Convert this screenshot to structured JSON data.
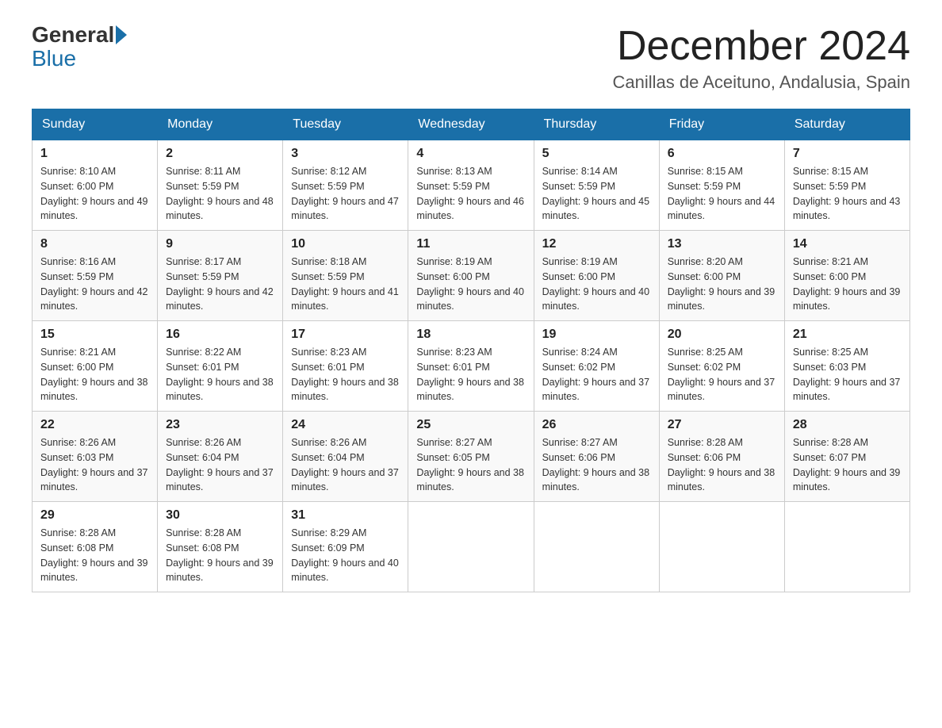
{
  "header": {
    "logo_general": "General",
    "logo_blue": "Blue",
    "month_title": "December 2024",
    "location": "Canillas de Aceituno, Andalusia, Spain"
  },
  "days_of_week": [
    "Sunday",
    "Monday",
    "Tuesday",
    "Wednesday",
    "Thursday",
    "Friday",
    "Saturday"
  ],
  "weeks": [
    [
      {
        "day": "1",
        "sunrise": "8:10 AM",
        "sunset": "6:00 PM",
        "daylight": "9 hours and 49 minutes."
      },
      {
        "day": "2",
        "sunrise": "8:11 AM",
        "sunset": "5:59 PM",
        "daylight": "9 hours and 48 minutes."
      },
      {
        "day": "3",
        "sunrise": "8:12 AM",
        "sunset": "5:59 PM",
        "daylight": "9 hours and 47 minutes."
      },
      {
        "day": "4",
        "sunrise": "8:13 AM",
        "sunset": "5:59 PM",
        "daylight": "9 hours and 46 minutes."
      },
      {
        "day": "5",
        "sunrise": "8:14 AM",
        "sunset": "5:59 PM",
        "daylight": "9 hours and 45 minutes."
      },
      {
        "day": "6",
        "sunrise": "8:15 AM",
        "sunset": "5:59 PM",
        "daylight": "9 hours and 44 minutes."
      },
      {
        "day": "7",
        "sunrise": "8:15 AM",
        "sunset": "5:59 PM",
        "daylight": "9 hours and 43 minutes."
      }
    ],
    [
      {
        "day": "8",
        "sunrise": "8:16 AM",
        "sunset": "5:59 PM",
        "daylight": "9 hours and 42 minutes."
      },
      {
        "day": "9",
        "sunrise": "8:17 AM",
        "sunset": "5:59 PM",
        "daylight": "9 hours and 42 minutes."
      },
      {
        "day": "10",
        "sunrise": "8:18 AM",
        "sunset": "5:59 PM",
        "daylight": "9 hours and 41 minutes."
      },
      {
        "day": "11",
        "sunrise": "8:19 AM",
        "sunset": "6:00 PM",
        "daylight": "9 hours and 40 minutes."
      },
      {
        "day": "12",
        "sunrise": "8:19 AM",
        "sunset": "6:00 PM",
        "daylight": "9 hours and 40 minutes."
      },
      {
        "day": "13",
        "sunrise": "8:20 AM",
        "sunset": "6:00 PM",
        "daylight": "9 hours and 39 minutes."
      },
      {
        "day": "14",
        "sunrise": "8:21 AM",
        "sunset": "6:00 PM",
        "daylight": "9 hours and 39 minutes."
      }
    ],
    [
      {
        "day": "15",
        "sunrise": "8:21 AM",
        "sunset": "6:00 PM",
        "daylight": "9 hours and 38 minutes."
      },
      {
        "day": "16",
        "sunrise": "8:22 AM",
        "sunset": "6:01 PM",
        "daylight": "9 hours and 38 minutes."
      },
      {
        "day": "17",
        "sunrise": "8:23 AM",
        "sunset": "6:01 PM",
        "daylight": "9 hours and 38 minutes."
      },
      {
        "day": "18",
        "sunrise": "8:23 AM",
        "sunset": "6:01 PM",
        "daylight": "9 hours and 38 minutes."
      },
      {
        "day": "19",
        "sunrise": "8:24 AM",
        "sunset": "6:02 PM",
        "daylight": "9 hours and 37 minutes."
      },
      {
        "day": "20",
        "sunrise": "8:25 AM",
        "sunset": "6:02 PM",
        "daylight": "9 hours and 37 minutes."
      },
      {
        "day": "21",
        "sunrise": "8:25 AM",
        "sunset": "6:03 PM",
        "daylight": "9 hours and 37 minutes."
      }
    ],
    [
      {
        "day": "22",
        "sunrise": "8:26 AM",
        "sunset": "6:03 PM",
        "daylight": "9 hours and 37 minutes."
      },
      {
        "day": "23",
        "sunrise": "8:26 AM",
        "sunset": "6:04 PM",
        "daylight": "9 hours and 37 minutes."
      },
      {
        "day": "24",
        "sunrise": "8:26 AM",
        "sunset": "6:04 PM",
        "daylight": "9 hours and 37 minutes."
      },
      {
        "day": "25",
        "sunrise": "8:27 AM",
        "sunset": "6:05 PM",
        "daylight": "9 hours and 38 minutes."
      },
      {
        "day": "26",
        "sunrise": "8:27 AM",
        "sunset": "6:06 PM",
        "daylight": "9 hours and 38 minutes."
      },
      {
        "day": "27",
        "sunrise": "8:28 AM",
        "sunset": "6:06 PM",
        "daylight": "9 hours and 38 minutes."
      },
      {
        "day": "28",
        "sunrise": "8:28 AM",
        "sunset": "6:07 PM",
        "daylight": "9 hours and 39 minutes."
      }
    ],
    [
      {
        "day": "29",
        "sunrise": "8:28 AM",
        "sunset": "6:08 PM",
        "daylight": "9 hours and 39 minutes."
      },
      {
        "day": "30",
        "sunrise": "8:28 AM",
        "sunset": "6:08 PM",
        "daylight": "9 hours and 39 minutes."
      },
      {
        "day": "31",
        "sunrise": "8:29 AM",
        "sunset": "6:09 PM",
        "daylight": "9 hours and 40 minutes."
      },
      null,
      null,
      null,
      null
    ]
  ]
}
